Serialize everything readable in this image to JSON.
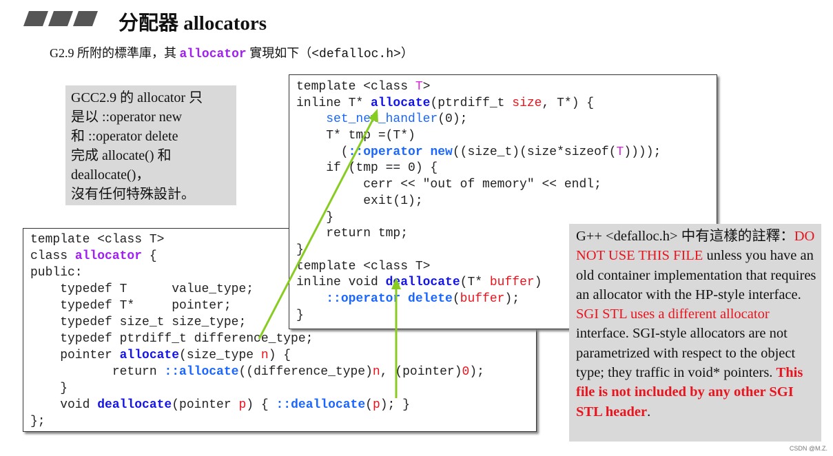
{
  "header": {
    "title": "分配器 allocators",
    "subtitle_prefix": "G2.9 所附的標準庫，其 ",
    "subtitle_keyword": "allocator",
    "subtitle_middle": " 實現如下（",
    "subtitle_file": "<defalloc.h>",
    "subtitle_suffix": "）"
  },
  "note_left": {
    "lines": [
      "GCC2.9 的 allocator 只",
      "是以 ::operator new",
      "和 ::operator delete",
      "完成 allocate() 和",
      "deallocate()，",
      "沒有任何特殊設計。"
    ]
  },
  "note_right": {
    "p1": "G++ <defalloc.h> 中有這樣的註釋：",
    "p2_red": "DO NOT USE THIS FILE",
    "p3": " unless you have an old container implementation that requires an allocator with the HP-style interface. ",
    "p4_red": "SGI STL uses a different allocator",
    "p5": " interface.  SGI-style allocators are not parametrized with respect to the object type; they traffic in void* pointers.  ",
    "p6_redbold": "This file is not included by any other SGI STL header",
    "p7": "."
  },
  "code_upper": [
    [
      [
        "template <class ",
        ""
      ],
      [
        "T",
        "mag"
      ],
      [
        ">",
        ""
      ]
    ],
    [
      [
        "inline T* ",
        ""
      ],
      [
        "allocate",
        "blue"
      ],
      [
        "(ptrdiff_t ",
        ""
      ],
      [
        "size",
        "red"
      ],
      [
        ", T*) {",
        ""
      ]
    ],
    [
      [
        "    ",
        ""
      ],
      [
        "set_new_handler",
        "lblue"
      ],
      [
        "(0);",
        ""
      ]
    ],
    [
      [
        "    T* tmp =(T*)",
        ""
      ]
    ],
    [
      [
        "      (",
        ""
      ],
      [
        "::operator new",
        "lblueb"
      ],
      [
        "((size_t)(size*sizeof(",
        ""
      ],
      [
        "T",
        "mag"
      ],
      [
        "))));",
        ""
      ]
    ],
    [
      [
        "    if (tmp == 0) {",
        ""
      ]
    ],
    [
      [
        "         cerr << \"out of memory\" << endl;",
        ""
      ]
    ],
    [
      [
        "         exit(1);",
        ""
      ]
    ],
    [
      [
        "    }",
        ""
      ]
    ],
    [
      [
        "    return tmp;",
        ""
      ]
    ],
    [
      [
        "}",
        ""
      ]
    ],
    [
      [
        "template <class T>",
        ""
      ]
    ],
    [
      [
        "inline void ",
        ""
      ],
      [
        "deallocate",
        "blue"
      ],
      [
        "(T* ",
        ""
      ],
      [
        "buffer",
        "red"
      ],
      [
        ")",
        ""
      ]
    ],
    [
      [
        "    ",
        ""
      ],
      [
        "::operator delete",
        "lblueb"
      ],
      [
        "(",
        ""
      ],
      [
        "buffer",
        "red"
      ],
      [
        ");",
        ""
      ]
    ],
    [
      [
        "}",
        ""
      ]
    ]
  ],
  "code_lower": [
    [
      [
        "template <class T>",
        ""
      ]
    ],
    [
      [
        "class ",
        ""
      ],
      [
        "allocator",
        "purple"
      ],
      [
        " {",
        ""
      ]
    ],
    [
      [
        "public:",
        ""
      ]
    ],
    [
      [
        "    typedef T      value_type;",
        ""
      ]
    ],
    [
      [
        "    typedef T*     pointer;",
        ""
      ]
    ],
    [
      [
        "    typedef size_t size_type;",
        ""
      ]
    ],
    [
      [
        "    typedef ptrdiff_t difference_type;",
        ""
      ]
    ],
    [
      [
        "    pointer ",
        ""
      ],
      [
        "allocate",
        "blue"
      ],
      [
        "(size_type ",
        ""
      ],
      [
        "n",
        "red"
      ],
      [
        ") {",
        ""
      ]
    ],
    [
      [
        "           return ",
        ""
      ],
      [
        "::allocate",
        "lblueb"
      ],
      [
        "((difference_type)",
        ""
      ],
      [
        "n",
        "red"
      ],
      [
        ", (pointer)",
        ""
      ],
      [
        "0",
        "red"
      ],
      [
        ");",
        ""
      ]
    ],
    [
      [
        "    }",
        ""
      ]
    ],
    [
      [
        "    void ",
        ""
      ],
      [
        "deallocate",
        "blue"
      ],
      [
        "(pointer ",
        ""
      ],
      [
        "p",
        "red"
      ],
      [
        ") { ",
        ""
      ],
      [
        "::deallocate",
        "lblueb"
      ],
      [
        "(",
        ""
      ],
      [
        "p",
        "red"
      ],
      [
        "); }",
        ""
      ]
    ],
    [
      [
        "};",
        ""
      ]
    ]
  ],
  "colors": {
    "arrow": "#88cc22",
    "note_bg": "#d9d9d9",
    "red": "#e8141e",
    "keyword_blue": "#1414e6",
    "purple": "#a020f0"
  },
  "credit": "CSDN @M.Z."
}
